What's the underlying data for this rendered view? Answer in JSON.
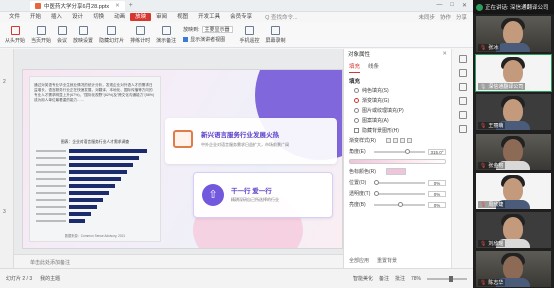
{
  "titlebar": {
    "doc_tab": "中医药大学分享6月28.pptx",
    "window_buttons": [
      "—",
      "□",
      "✕"
    ]
  },
  "menubar": {
    "items": [
      "文件",
      "开始",
      "插入",
      "设计",
      "切换",
      "动画",
      "放映",
      "审阅",
      "视图",
      "开发工具",
      "会员专享"
    ],
    "active_index": 6,
    "search_hint": "Q 查找命令...",
    "right": [
      "未同步",
      "协作",
      "分享"
    ]
  },
  "ribbon": {
    "buttons": [
      {
        "label": "从头开始",
        "icon": "play-from-start-icon"
      },
      {
        "label": "当页开始",
        "icon": "play-current-icon"
      },
      {
        "label": "会议",
        "icon": "meeting-icon"
      },
      {
        "label": "放映设置",
        "icon": "slideshow-settings-icon"
      },
      {
        "label": "隐藏幻灯片",
        "icon": "hide-slide-icon"
      },
      {
        "label": "排练计时",
        "icon": "rehearse-timing-icon"
      },
      {
        "label": "演示备注",
        "icon": "presenter-notes-icon"
      }
    ],
    "display_label": "放映到:",
    "display_value": "主要显示器",
    "presenter_view": "显示演讲者视图",
    "right_buttons": [
      {
        "label": "手机遥控",
        "icon": "phone-remote-icon"
      },
      {
        "label": "屏幕录制",
        "icon": "screen-record-icon"
      }
    ]
  },
  "leftstrip": {
    "numbers": [
      "2",
      "3"
    ]
  },
  "slide": {
    "photo_text": "通过对英语专业毕业生就业情况的统计分析，发现企业对外语人才的需求日益增长，语言服务行业正在快速发展，对翻译、本地化、国际传播等方向的专业人才需求明显上升(67%)，\"国际化视野\"(62%)及\"跨文化沟通能力\"(58%)成为用人单位最看重的能力……",
    "chart_title": "图表：企业对语言服务行业人才需求调查",
    "chart_source": "数据来源：Common Sense Advisory, 2021",
    "card1_title": "新兴语言服务行业发展火热",
    "card1_sub": "中外企业对语言服务需求日益扩大，市场前景广阔",
    "card2_title": "干一行 爱一行",
    "card2_sub": "精耕深研自己所选择的行业"
  },
  "notes_hint": "单击此处添加备注",
  "panel": {
    "title": "对象属性",
    "tabs": [
      "填充",
      "线条"
    ],
    "section": "填充",
    "options": [
      {
        "label": "纯色填充(S)",
        "on": false
      },
      {
        "label": "渐变填充(G)",
        "on": true
      },
      {
        "label": "图片或纹理填充(P)",
        "on": false
      },
      {
        "label": "图案填充(A)",
        "on": false
      },
      {
        "label": "隐藏背景图形(H)",
        "on": false
      }
    ],
    "gradient_label": "渐变样式(R)",
    "angle_label": "角度(E)",
    "angle_value": "315.0°",
    "stops_label": "色标颜色(R)",
    "position_label": "位置(O)",
    "position_value": "0%",
    "transparency_label": "透明度(T)",
    "transparency_value": "0%",
    "brightness_label": "亮度(B)",
    "brightness_value": "0%",
    "footer": [
      "全部应用",
      "重置背景"
    ]
  },
  "status": {
    "left": [
      "幻灯片 2 / 3",
      "我的主题"
    ],
    "right": [
      "智能美化",
      "备注",
      "批注"
    ],
    "zoom": "78%"
  },
  "meeting": {
    "speaking_label": "正在讲话: 深信通翻译公司",
    "participants": [
      {
        "name": "张冰",
        "mic": "muted"
      },
      {
        "name": "深信通翻译公司",
        "mic": "on"
      },
      {
        "name": "王丽萌",
        "mic": "muted"
      },
      {
        "name": "张金榕",
        "mic": "muted"
      },
      {
        "name": "周欣婕",
        "mic": "muted"
      },
      {
        "name": "刘欣瑶",
        "mic": "muted"
      },
      {
        "name": "陈志华",
        "mic": "muted"
      }
    ]
  }
}
